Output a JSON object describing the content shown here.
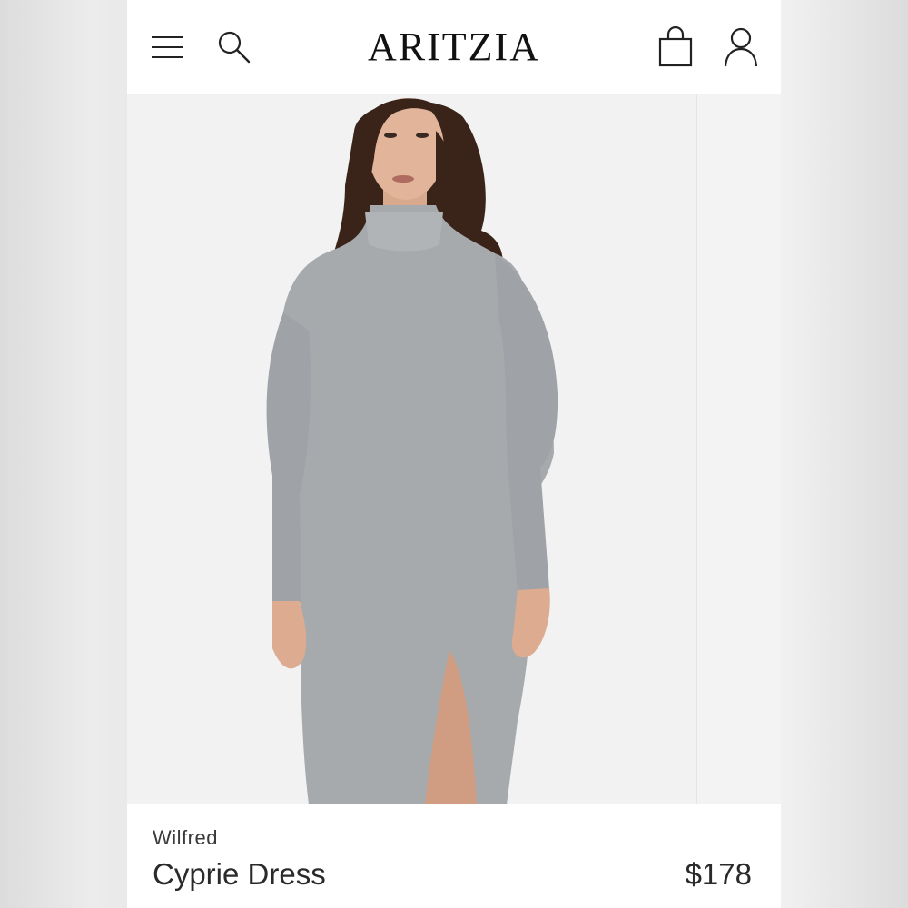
{
  "header": {
    "brand": "ARITZIA",
    "menu_icon": "menu-icon",
    "search_icon": "search-icon",
    "bag_icon": "shopping-bag-icon",
    "account_icon": "account-icon"
  },
  "product": {
    "image_alt": "Model wearing a grey turtleneck knit midi dress with side slit",
    "brand": "Wilfred",
    "name": "Cyprie Dress",
    "price": "$178",
    "color_swatch": "#a7aaad"
  }
}
